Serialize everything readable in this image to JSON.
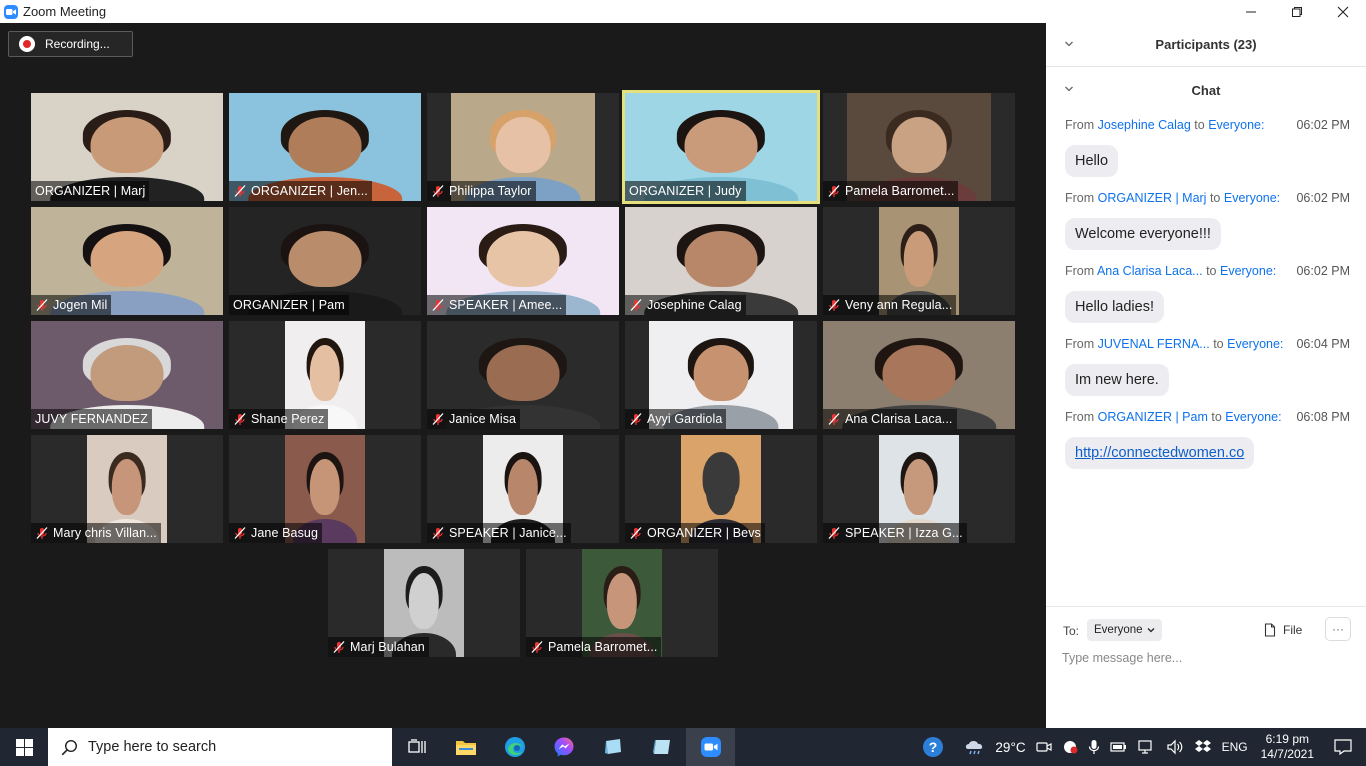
{
  "window": {
    "title": "Zoom Meeting",
    "controls": [
      "minimize",
      "maximize",
      "close"
    ]
  },
  "meeting": {
    "recording_label": "Recording...",
    "participants": [
      {
        "name": "ORGANIZER | Marj",
        "muted": false,
        "active": false
      },
      {
        "name": "ORGANIZER | Jen...",
        "muted": true,
        "active": false
      },
      {
        "name": "Philippa Taylor",
        "muted": true,
        "active": false
      },
      {
        "name": "ORGANIZER | Judy",
        "muted": false,
        "active": true
      },
      {
        "name": "Pamela Barromet...",
        "muted": true,
        "active": false
      },
      {
        "name": "Jogen Mil",
        "muted": true,
        "active": false
      },
      {
        "name": "ORGANIZER |  Pam",
        "muted": false,
        "active": false
      },
      {
        "name": "SPEAKER | Amee...",
        "muted": true,
        "active": false
      },
      {
        "name": "Josephine Calag",
        "muted": true,
        "active": false
      },
      {
        "name": "Veny ann Regula...",
        "muted": true,
        "active": false
      },
      {
        "name": "JUVY  FERNANDEZ",
        "muted": false,
        "active": false
      },
      {
        "name": "Shane Perez",
        "muted": true,
        "active": false
      },
      {
        "name": "Janice Misa",
        "muted": true,
        "active": false
      },
      {
        "name": "Ayyi Gardiola",
        "muted": true,
        "active": false
      },
      {
        "name": "Ana Clarisa Laca...",
        "muted": true,
        "active": false
      },
      {
        "name": "Mary chris Villan...",
        "muted": true,
        "active": false
      },
      {
        "name": "Jane Basug",
        "muted": true,
        "active": false
      },
      {
        "name": "SPEAKER | Janice...",
        "muted": true,
        "active": false
      },
      {
        "name": "ORGANIZER | Bevs",
        "muted": true,
        "active": false
      },
      {
        "name": "SPEAKER | Izza G...",
        "muted": true,
        "active": false
      },
      {
        "name": "Marj Bulahan",
        "muted": true,
        "active": false
      },
      {
        "name": "Pamela Barromet...",
        "muted": true,
        "active": false
      }
    ]
  },
  "panel": {
    "participants_header": "Participants (23)",
    "chat_header": "Chat",
    "messages": [
      {
        "from_label": "From",
        "sender": "Josephine Calag",
        "to_label": "to",
        "recipient": "Everyone:",
        "time": "06:02 PM",
        "text": "Hello",
        "is_link": false
      },
      {
        "from_label": "From",
        "sender": "ORGANIZER | Marj",
        "to_label": "to",
        "recipient": "Everyone:",
        "time": "06:02 PM",
        "text": "Welcome everyone!!!",
        "is_link": false
      },
      {
        "from_label": "From",
        "sender": "Ana Clarisa Laca...",
        "to_label": "to",
        "recipient": "Everyone:",
        "time": "06:02 PM",
        "text": "Hello ladies!",
        "is_link": false
      },
      {
        "from_label": "From",
        "sender": "JUVENAL FERNA...",
        "to_label": "to",
        "recipient": "Everyone:",
        "time": "06:04 PM",
        "text": "Im new here.",
        "is_link": false
      },
      {
        "from_label": "From",
        "sender": "ORGANIZER |  Pam",
        "to_label": "to",
        "recipient": "Everyone:",
        "time": "06:08 PM",
        "text": "http://connectedwomen.co",
        "is_link": true
      }
    ],
    "compose": {
      "to_label": "To:",
      "recipient": "Everyone",
      "file_label": "File",
      "more_label": "···",
      "placeholder": "Type message here..."
    }
  },
  "taskbar": {
    "search_placeholder": "Type here to search",
    "apps": [
      "task-view",
      "file-explorer",
      "edge",
      "messenger",
      "sticky-notes",
      "notes",
      "zoom"
    ],
    "weather": "29°C",
    "language": "ENG",
    "time": "6:19 pm",
    "date": "14/7/2021"
  },
  "colors": {
    "active_speaker_border": "#e6e07c",
    "link_blue": "#0e72ed",
    "zoom_blue": "#2d8cff",
    "meeting_bg": "#1a1a1a",
    "taskbar_bg": "#202733"
  }
}
